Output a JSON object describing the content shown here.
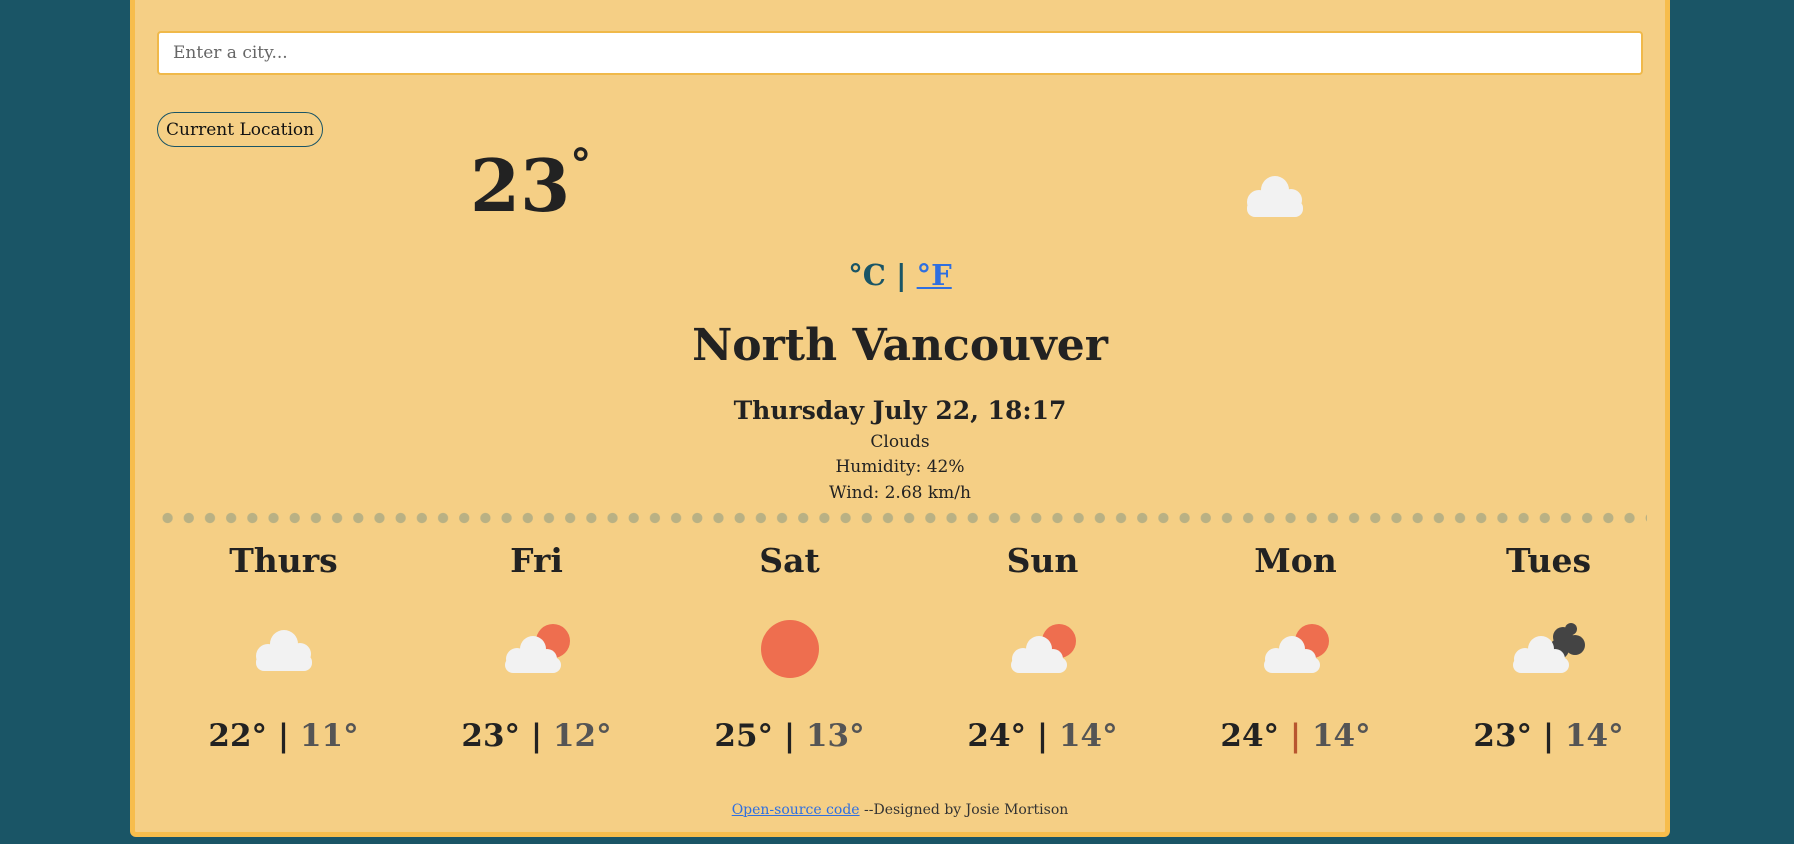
{
  "search": {
    "placeholder": "Enter a city..."
  },
  "location_button": {
    "label": "Current Location"
  },
  "current": {
    "temperature": "23",
    "degree": "°",
    "icon": "cloud-icon",
    "unit_celsius": "°C",
    "unit_separator": "|",
    "unit_fahrenheit": "°F",
    "city": "North Vancouver",
    "datetime": "Thursday July 22, 18:17",
    "description": "Clouds",
    "humidity": "Humidity: 42%",
    "wind": "Wind: 2.68 km/h"
  },
  "forecast": [
    {
      "day": "Thurs",
      "icon": "cloud-icon",
      "high": "22°",
      "low": "11°"
    },
    {
      "day": "Fri",
      "icon": "partly-sunny-icon",
      "high": "23°",
      "low": "12°"
    },
    {
      "day": "Sat",
      "icon": "sun-icon",
      "high": "25°",
      "low": "13°"
    },
    {
      "day": "Sun",
      "icon": "partly-sunny-icon",
      "high": "24°",
      "low": "14°"
    },
    {
      "day": "Mon",
      "icon": "partly-sunny-icon",
      "high": "24°",
      "low": "14°"
    },
    {
      "day": "Tues",
      "icon": "dark-clouds-icon",
      "high": "23°",
      "low": "14°"
    }
  ],
  "forecast_separator": "|",
  "footer": {
    "link_text": "Open-source code",
    "credit": " --Designed by Josie Mortison"
  },
  "colors": {
    "background": "#1a5566",
    "card": "#f5cf85",
    "card_border": "#f7bd4c",
    "sun": "#ee6e4f",
    "cloud": "#f2f2f2",
    "dark_cloud": "#444444",
    "link": "#2f6fe0",
    "dots": "#b9b184"
  }
}
